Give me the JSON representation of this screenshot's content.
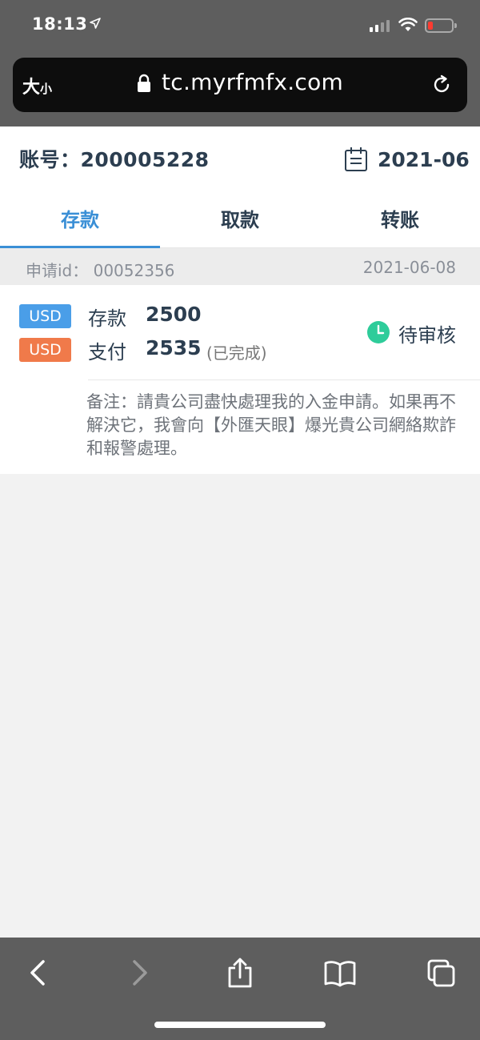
{
  "status_bar": {
    "time": "18:13"
  },
  "browser": {
    "text_size_label": "大",
    "text_size_small": "小",
    "url": "tc.myrfmfx.com"
  },
  "account": {
    "label": "账号：200005228",
    "month": "2021-06"
  },
  "tabs": [
    {
      "label": "存款",
      "active": true
    },
    {
      "label": "取款",
      "active": false
    },
    {
      "label": "转账",
      "active": false
    }
  ],
  "record": {
    "id_label": "申请id：  00052356",
    "date": "2021-06-08",
    "currency1": "USD",
    "type1": "存款",
    "amount1": "2500",
    "currency2": "USD",
    "type2": "支付",
    "amount2": "2535",
    "completed": "(已完成)",
    "status": "待审核",
    "note": "备注：請貴公司盡快處理我的入金申請。如果再不解決它，我會向【外匯天眼】爆光貴公司網絡欺詐和報警處理。"
  },
  "colors": {
    "accent": "#3a8fd6",
    "badge_blue": "#4a9ee8",
    "badge_orange": "#f07a4a",
    "status_green": "#2ecc9a"
  },
  "icons": [
    "location-arrow-icon",
    "signal-icon",
    "wifi-icon",
    "battery-icon",
    "lock-icon",
    "reload-icon",
    "calendar-icon",
    "clock-icon",
    "back-icon",
    "forward-icon",
    "share-icon",
    "bookmarks-icon",
    "tabs-icon"
  ]
}
